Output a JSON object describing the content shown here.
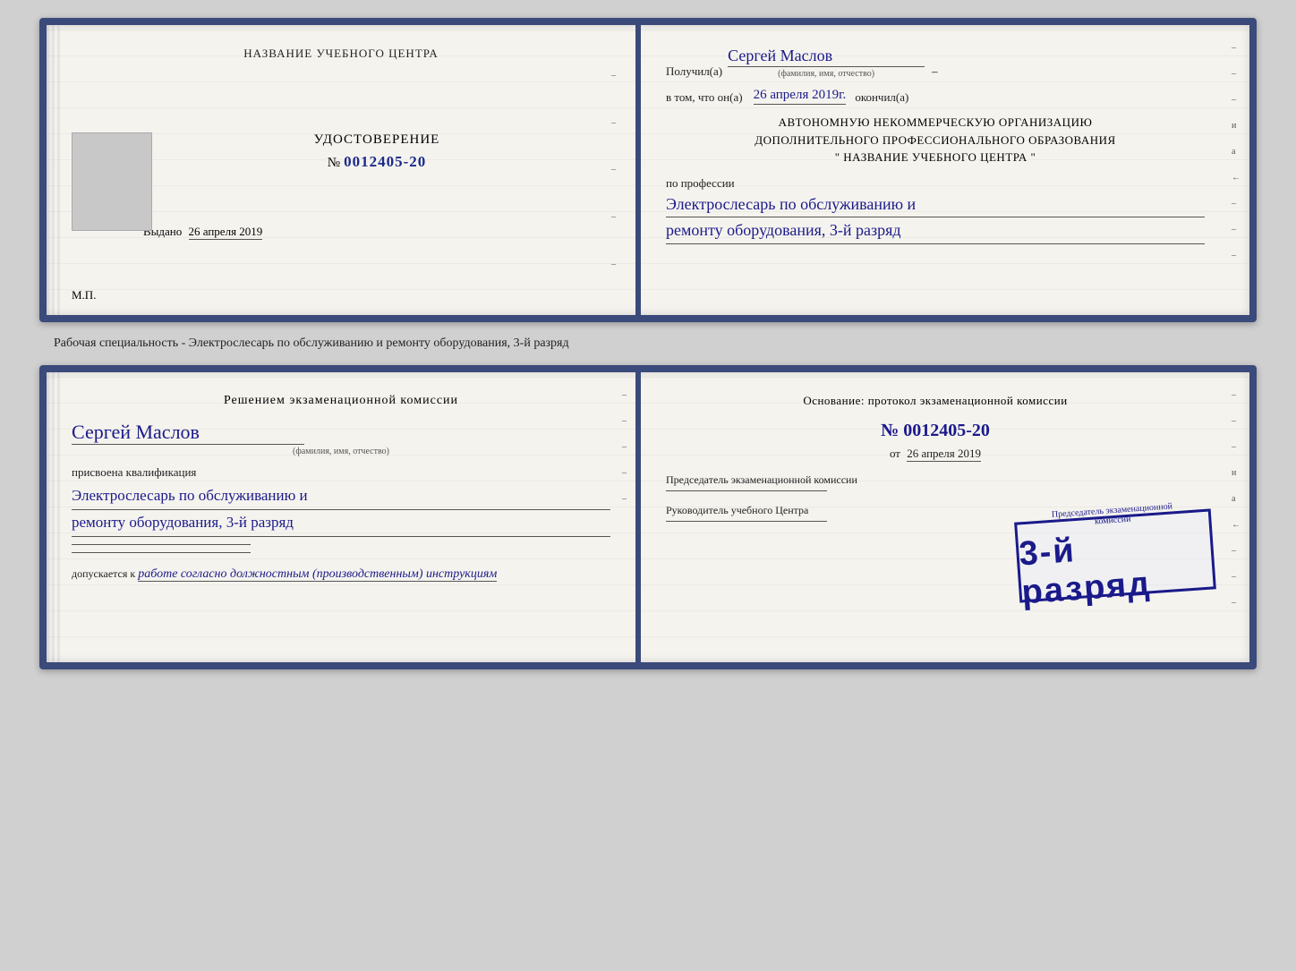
{
  "card1": {
    "left": {
      "center_title": "НАЗВАНИЕ УЧЕБНОГО ЦЕНТРА",
      "udostoverenie_title": "УДОСТОВЕРЕНИЕ",
      "number_label": "№",
      "number": "0012405-20",
      "vydano_label": "Выдано",
      "vydano_date": "26 апреля 2019",
      "mp_label": "М.П."
    },
    "right": {
      "poluchil_label": "Получил(а)",
      "poluchil_value": "Сергей Маслов",
      "poluchil_subtext": "(фамилия, имя, отчество)",
      "vtom_label": "в том, что он(а)",
      "vtom_date": "26 апреля 2019г.",
      "okonchil_label": "окончил(а)",
      "block_line1": "АВТОНОМНУЮ НЕКОММЕРЧЕСКУЮ ОРГАНИЗАЦИЮ",
      "block_line2": "ДОПОЛНИТЕЛЬНОГО ПРОФЕССИОНАЛЬНОГО ОБРАЗОВАНИЯ",
      "block_line3": "\" НАЗВАНИЕ УЧЕБНОГО ЦЕНТРА \"",
      "po_professii_label": "по профессии",
      "profession_line1": "Электрослесарь по обслуживанию и",
      "profession_line2": "ремонту оборудования, 3-й разряд"
    }
  },
  "between_label": "Рабочая специальность - Электрослесарь по обслуживанию и ремонту оборудования, 3-й разряд",
  "card2": {
    "left": {
      "komissia_title": "Решением экзаменационной комиссии",
      "name_value": "Сергей Маслов",
      "name_subtext": "(фамилия, имя, отчество)",
      "prisvoena_text": "присвоена квалификация",
      "kvalif_line1": "Электрослесарь по обслуживанию и",
      "kvalif_line2": "ремонту оборудования, 3-й разряд",
      "dopuskaetsya_label": "допускается к",
      "dopuskaetsya_value": "работе согласно должностным (производственным) инструкциям"
    },
    "right": {
      "osnovanie_title": "Основание: протокол экзаменационной комиссии",
      "number_label": "№",
      "number": "0012405-20",
      "ot_label": "от",
      "ot_date": "26 апреля 2019",
      "predsedatel_text": "Председатель экзаменационной комиссии",
      "rukovoditel_text": "Руководитель учебного Центра"
    },
    "stamp": {
      "sub_text": "Председатель экзаменационной\nкомиссии",
      "main_text": "3-й разряд"
    }
  },
  "tick_marks": [
    "-",
    "-",
    "-",
    "и",
    "а",
    "←",
    "-",
    "-",
    "-"
  ],
  "tick_marks2": [
    "-",
    "-",
    "-",
    "и",
    "а",
    "←",
    "-",
    "-",
    "-"
  ]
}
